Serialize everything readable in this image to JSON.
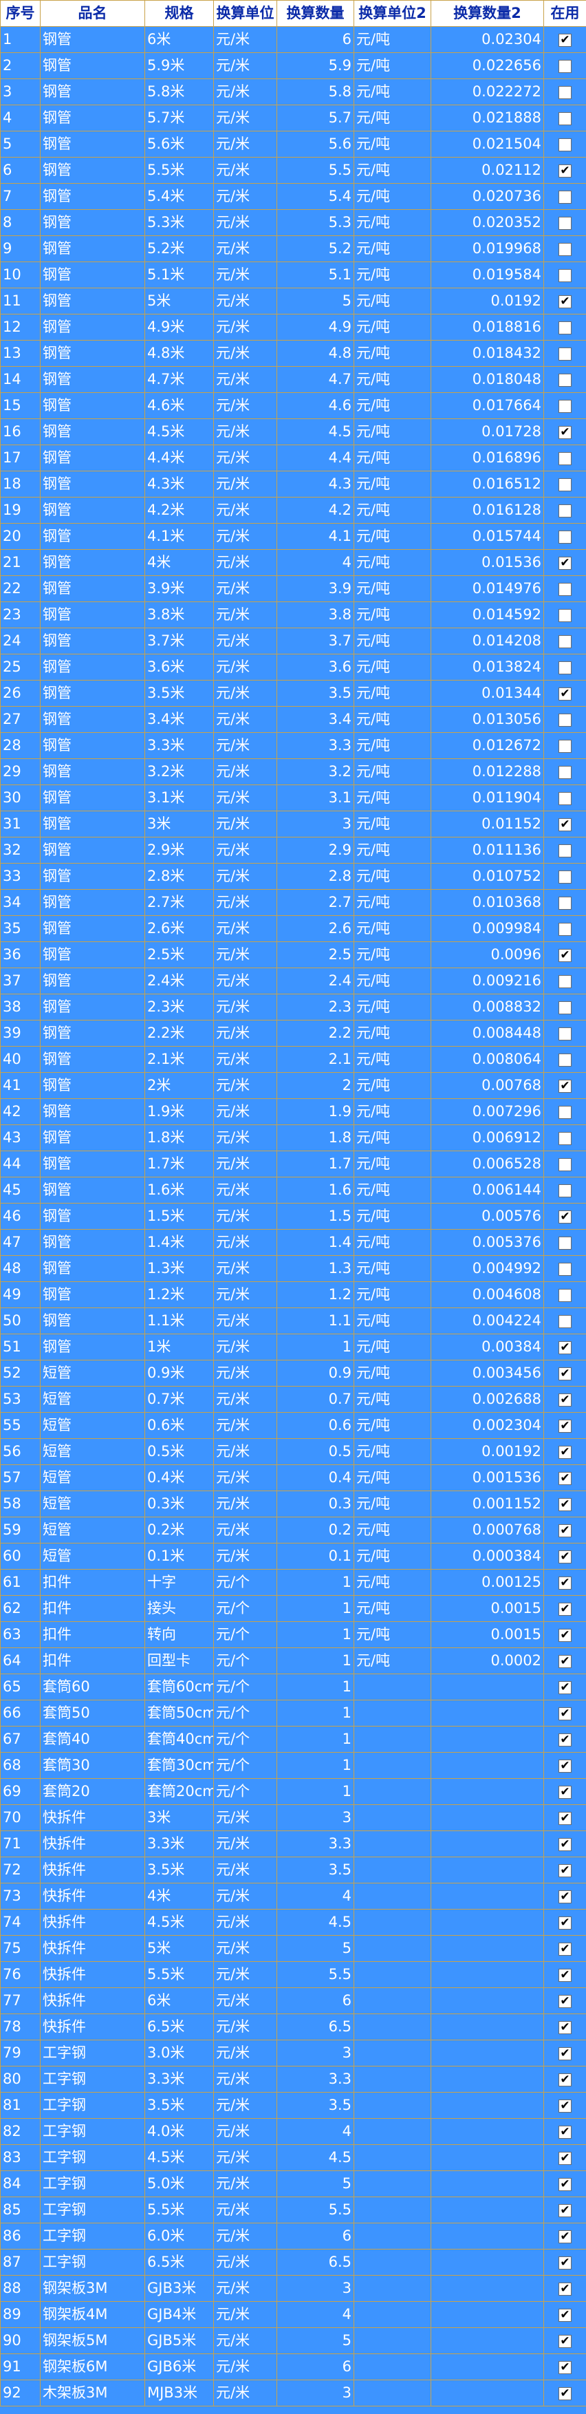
{
  "columns": [
    "序号",
    "品名",
    "规格",
    "换算单位",
    "换算数量",
    "换算单位2",
    "换算数量2",
    "在用"
  ],
  "rows": [
    [
      "1",
      "钢管",
      "6米",
      "元/米",
      "6",
      "元/吨",
      "0.02304",
      true
    ],
    [
      "2",
      "钢管",
      "5.9米",
      "元/米",
      "5.9",
      "元/吨",
      "0.022656",
      false
    ],
    [
      "3",
      "钢管",
      "5.8米",
      "元/米",
      "5.8",
      "元/吨",
      "0.022272",
      false
    ],
    [
      "4",
      "钢管",
      "5.7米",
      "元/米",
      "5.7",
      "元/吨",
      "0.021888",
      false
    ],
    [
      "5",
      "钢管",
      "5.6米",
      "元/米",
      "5.6",
      "元/吨",
      "0.021504",
      false
    ],
    [
      "6",
      "钢管",
      "5.5米",
      "元/米",
      "5.5",
      "元/吨",
      "0.02112",
      true
    ],
    [
      "7",
      "钢管",
      "5.4米",
      "元/米",
      "5.4",
      "元/吨",
      "0.020736",
      false
    ],
    [
      "8",
      "钢管",
      "5.3米",
      "元/米",
      "5.3",
      "元/吨",
      "0.020352",
      false
    ],
    [
      "9",
      "钢管",
      "5.2米",
      "元/米",
      "5.2",
      "元/吨",
      "0.019968",
      false
    ],
    [
      "10",
      "钢管",
      "5.1米",
      "元/米",
      "5.1",
      "元/吨",
      "0.019584",
      false
    ],
    [
      "11",
      "钢管",
      "5米",
      "元/米",
      "5",
      "元/吨",
      "0.0192",
      true
    ],
    [
      "12",
      "钢管",
      "4.9米",
      "元/米",
      "4.9",
      "元/吨",
      "0.018816",
      false
    ],
    [
      "13",
      "钢管",
      "4.8米",
      "元/米",
      "4.8",
      "元/吨",
      "0.018432",
      false
    ],
    [
      "14",
      "钢管",
      "4.7米",
      "元/米",
      "4.7",
      "元/吨",
      "0.018048",
      false
    ],
    [
      "15",
      "钢管",
      "4.6米",
      "元/米",
      "4.6",
      "元/吨",
      "0.017664",
      false
    ],
    [
      "16",
      "钢管",
      "4.5米",
      "元/米",
      "4.5",
      "元/吨",
      "0.01728",
      true
    ],
    [
      "17",
      "钢管",
      "4.4米",
      "元/米",
      "4.4",
      "元/吨",
      "0.016896",
      false
    ],
    [
      "18",
      "钢管",
      "4.3米",
      "元/米",
      "4.3",
      "元/吨",
      "0.016512",
      false
    ],
    [
      "19",
      "钢管",
      "4.2米",
      "元/米",
      "4.2",
      "元/吨",
      "0.016128",
      false
    ],
    [
      "20",
      "钢管",
      "4.1米",
      "元/米",
      "4.1",
      "元/吨",
      "0.015744",
      false
    ],
    [
      "21",
      "钢管",
      "4米",
      "元/米",
      "4",
      "元/吨",
      "0.01536",
      true
    ],
    [
      "22",
      "钢管",
      "3.9米",
      "元/米",
      "3.9",
      "元/吨",
      "0.014976",
      false
    ],
    [
      "23",
      "钢管",
      "3.8米",
      "元/米",
      "3.8",
      "元/吨",
      "0.014592",
      false
    ],
    [
      "24",
      "钢管",
      "3.7米",
      "元/米",
      "3.7",
      "元/吨",
      "0.014208",
      false
    ],
    [
      "25",
      "钢管",
      "3.6米",
      "元/米",
      "3.6",
      "元/吨",
      "0.013824",
      false
    ],
    [
      "26",
      "钢管",
      "3.5米",
      "元/米",
      "3.5",
      "元/吨",
      "0.01344",
      true
    ],
    [
      "27",
      "钢管",
      "3.4米",
      "元/米",
      "3.4",
      "元/吨",
      "0.013056",
      false
    ],
    [
      "28",
      "钢管",
      "3.3米",
      "元/米",
      "3.3",
      "元/吨",
      "0.012672",
      false
    ],
    [
      "29",
      "钢管",
      "3.2米",
      "元/米",
      "3.2",
      "元/吨",
      "0.012288",
      false
    ],
    [
      "30",
      "钢管",
      "3.1米",
      "元/米",
      "3.1",
      "元/吨",
      "0.011904",
      false
    ],
    [
      "31",
      "钢管",
      "3米",
      "元/米",
      "3",
      "元/吨",
      "0.01152",
      true
    ],
    [
      "32",
      "钢管",
      "2.9米",
      "元/米",
      "2.9",
      "元/吨",
      "0.011136",
      false
    ],
    [
      "33",
      "钢管",
      "2.8米",
      "元/米",
      "2.8",
      "元/吨",
      "0.010752",
      false
    ],
    [
      "34",
      "钢管",
      "2.7米",
      "元/米",
      "2.7",
      "元/吨",
      "0.010368",
      false
    ],
    [
      "35",
      "钢管",
      "2.6米",
      "元/米",
      "2.6",
      "元/吨",
      "0.009984",
      false
    ],
    [
      "36",
      "钢管",
      "2.5米",
      "元/米",
      "2.5",
      "元/吨",
      "0.0096",
      true
    ],
    [
      "37",
      "钢管",
      "2.4米",
      "元/米",
      "2.4",
      "元/吨",
      "0.009216",
      false
    ],
    [
      "38",
      "钢管",
      "2.3米",
      "元/米",
      "2.3",
      "元/吨",
      "0.008832",
      false
    ],
    [
      "39",
      "钢管",
      "2.2米",
      "元/米",
      "2.2",
      "元/吨",
      "0.008448",
      false
    ],
    [
      "40",
      "钢管",
      "2.1米",
      "元/米",
      "2.1",
      "元/吨",
      "0.008064",
      false
    ],
    [
      "41",
      "钢管",
      "2米",
      "元/米",
      "2",
      "元/吨",
      "0.00768",
      true
    ],
    [
      "42",
      "钢管",
      "1.9米",
      "元/米",
      "1.9",
      "元/吨",
      "0.007296",
      false
    ],
    [
      "43",
      "钢管",
      "1.8米",
      "元/米",
      "1.8",
      "元/吨",
      "0.006912",
      false
    ],
    [
      "44",
      "钢管",
      "1.7米",
      "元/米",
      "1.7",
      "元/吨",
      "0.006528",
      false
    ],
    [
      "45",
      "钢管",
      "1.6米",
      "元/米",
      "1.6",
      "元/吨",
      "0.006144",
      false
    ],
    [
      "46",
      "钢管",
      "1.5米",
      "元/米",
      "1.5",
      "元/吨",
      "0.00576",
      true
    ],
    [
      "47",
      "钢管",
      "1.4米",
      "元/米",
      "1.4",
      "元/吨",
      "0.005376",
      false
    ],
    [
      "48",
      "钢管",
      "1.3米",
      "元/米",
      "1.3",
      "元/吨",
      "0.004992",
      false
    ],
    [
      "49",
      "钢管",
      "1.2米",
      "元/米",
      "1.2",
      "元/吨",
      "0.004608",
      false
    ],
    [
      "50",
      "钢管",
      "1.1米",
      "元/米",
      "1.1",
      "元/吨",
      "0.004224",
      false
    ],
    [
      "51",
      "钢管",
      "1米",
      "元/米",
      "1",
      "元/吨",
      "0.00384",
      true
    ],
    [
      "52",
      "短管",
      "0.9米",
      "元/米",
      "0.9",
      "元/吨",
      "0.003456",
      true
    ],
    [
      "53",
      "短管",
      "0.7米",
      "元/米",
      "0.7",
      "元/吨",
      "0.002688",
      true
    ],
    [
      "55",
      "短管",
      "0.6米",
      "元/米",
      "0.6",
      "元/吨",
      "0.002304",
      true
    ],
    [
      "56",
      "短管",
      "0.5米",
      "元/米",
      "0.5",
      "元/吨",
      "0.00192",
      true
    ],
    [
      "57",
      "短管",
      "0.4米",
      "元/米",
      "0.4",
      "元/吨",
      "0.001536",
      true
    ],
    [
      "58",
      "短管",
      "0.3米",
      "元/米",
      "0.3",
      "元/吨",
      "0.001152",
      true
    ],
    [
      "59",
      "短管",
      "0.2米",
      "元/米",
      "0.2",
      "元/吨",
      "0.000768",
      true
    ],
    [
      "60",
      "短管",
      "0.1米",
      "元/米",
      "0.1",
      "元/吨",
      "0.000384",
      true
    ],
    [
      "61",
      "扣件",
      "十字",
      "元/个",
      "1",
      "元/吨",
      "0.00125",
      true
    ],
    [
      "62",
      "扣件",
      "接头",
      "元/个",
      "1",
      "元/吨",
      "0.0015",
      true
    ],
    [
      "63",
      "扣件",
      "转向",
      "元/个",
      "1",
      "元/吨",
      "0.0015",
      true
    ],
    [
      "64",
      "扣件",
      "回型卡",
      "元/个",
      "1",
      "元/吨",
      "0.0002",
      true
    ],
    [
      "65",
      "套筒60",
      "套筒60cm",
      "元/个",
      "1",
      "",
      "",
      true
    ],
    [
      "66",
      "套筒50",
      "套筒50cm",
      "元/个",
      "1",
      "",
      "",
      true
    ],
    [
      "67",
      "套筒40",
      "套筒40cm",
      "元/个",
      "1",
      "",
      "",
      true
    ],
    [
      "68",
      "套筒30",
      "套筒30cm",
      "元/个",
      "1",
      "",
      "",
      true
    ],
    [
      "69",
      "套筒20",
      "套筒20cm",
      "元/个",
      "1",
      "",
      "",
      true
    ],
    [
      "70",
      "快拆件",
      "3米",
      "元/米",
      "3",
      "",
      "",
      true
    ],
    [
      "71",
      "快拆件",
      "3.3米",
      "元/米",
      "3.3",
      "",
      "",
      true
    ],
    [
      "72",
      "快拆件",
      "3.5米",
      "元/米",
      "3.5",
      "",
      "",
      true
    ],
    [
      "73",
      "快拆件",
      "4米",
      "元/米",
      "4",
      "",
      "",
      true
    ],
    [
      "74",
      "快拆件",
      "4.5米",
      "元/米",
      "4.5",
      "",
      "",
      true
    ],
    [
      "75",
      "快拆件",
      "5米",
      "元/米",
      "5",
      "",
      "",
      true
    ],
    [
      "76",
      "快拆件",
      "5.5米",
      "元/米",
      "5.5",
      "",
      "",
      true
    ],
    [
      "77",
      "快拆件",
      "6米",
      "元/米",
      "6",
      "",
      "",
      true
    ],
    [
      "78",
      "快拆件",
      "6.5米",
      "元/米",
      "6.5",
      "",
      "",
      true
    ],
    [
      "79",
      "工字钢",
      "3.0米",
      "元/米",
      "3",
      "",
      "",
      true
    ],
    [
      "80",
      "工字钢",
      "3.3米",
      "元/米",
      "3.3",
      "",
      "",
      true
    ],
    [
      "81",
      "工字钢",
      "3.5米",
      "元/米",
      "3.5",
      "",
      "",
      true
    ],
    [
      "82",
      "工字钢",
      "4.0米",
      "元/米",
      "4",
      "",
      "",
      true
    ],
    [
      "83",
      "工字钢",
      "4.5米",
      "元/米",
      "4.5",
      "",
      "",
      true
    ],
    [
      "84",
      "工字钢",
      "5.0米",
      "元/米",
      "5",
      "",
      "",
      true
    ],
    [
      "85",
      "工字钢",
      "5.5米",
      "元/米",
      "5.5",
      "",
      "",
      true
    ],
    [
      "86",
      "工字钢",
      "6.0米",
      "元/米",
      "6",
      "",
      "",
      true
    ],
    [
      "87",
      "工字钢",
      "6.5米",
      "元/米",
      "6.5",
      "",
      "",
      true
    ],
    [
      "88",
      "钢架板3M",
      "GJB3米",
      "元/米",
      "3",
      "",
      "",
      true
    ],
    [
      "89",
      "钢架板4M",
      "GJB4米",
      "元/米",
      "4",
      "",
      "",
      true
    ],
    [
      "90",
      "钢架板5M",
      "GJB5米",
      "元/米",
      "5",
      "",
      "",
      true
    ],
    [
      "91",
      "钢架板6M",
      "GJB6米",
      "元/米",
      "6",
      "",
      "",
      true
    ],
    [
      "92",
      "木架板3M",
      "MJB3米",
      "元/米",
      "3",
      "",
      "",
      true
    ]
  ],
  "colors": {
    "row_bg": "#3d94ff",
    "header_bg": "#ffffff",
    "header_text": "#0a2aa8",
    "grid_line": "#c9a24a",
    "cell_text": "#ffffff"
  },
  "icons": {
    "checked": "check-icon"
  }
}
